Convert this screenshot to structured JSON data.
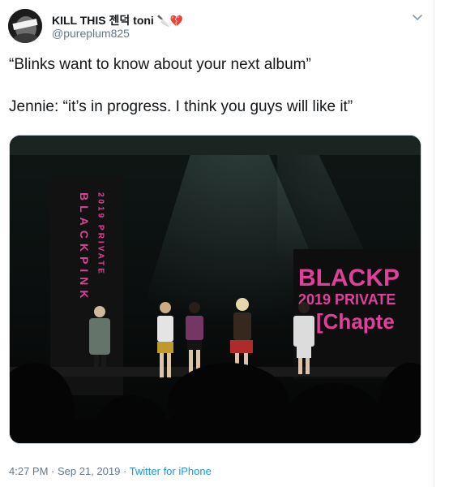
{
  "user": {
    "display_name": "KILL THIS 젠덕 toni",
    "name_emoji": "🔪💔",
    "handle": "@pureplum825"
  },
  "tweet": {
    "line1": "“Blinks want to know about your next album”",
    "line2": "Jennie: “it’s in progress. I think you guys will like it”"
  },
  "media": {
    "left_banner_title": "BLACKPINK",
    "left_banner_subtitle": "2019 PRIVATE",
    "screen_line1": "BLACKP",
    "screen_line2": "2019 PRIVATE",
    "screen_line3": "[Chapte"
  },
  "meta": {
    "time": "4:27 PM",
    "date": "Sep 21, 2019",
    "separator": " · ",
    "source": "Twitter for iPhone"
  },
  "colors": {
    "link": "#1b95e0",
    "secondary_text": "#657786",
    "stage_pink": "#e0409a"
  },
  "icons": {
    "caret": "chevron-down-icon"
  }
}
